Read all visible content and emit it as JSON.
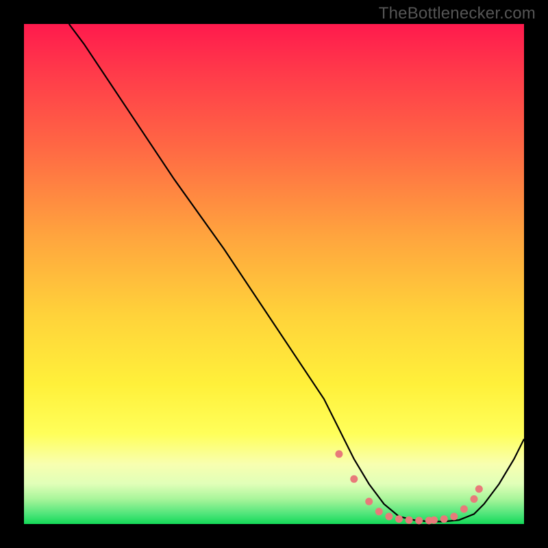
{
  "watermark": "TheBottlenecker.com",
  "chart_data": {
    "type": "line",
    "title": "",
    "xlabel": "",
    "ylabel": "",
    "xlim": [
      0,
      100
    ],
    "ylim": [
      0,
      100
    ],
    "series": [
      {
        "name": "curve",
        "x": [
          9,
          12,
          20,
          30,
          40,
          50,
          60,
          63,
          66,
          69,
          72,
          75,
          78,
          81,
          84,
          87,
          90,
          92,
          95,
          98,
          100
        ],
        "y": [
          100,
          96,
          84,
          69,
          55,
          40,
          25,
          19,
          13,
          8,
          4,
          1.5,
          0.8,
          0.5,
          0.5,
          0.8,
          2,
          4,
          8,
          13,
          17
        ]
      }
    ],
    "markers": {
      "name": "dots",
      "color": "#e87a7a",
      "x": [
        63,
        66,
        69,
        71,
        73,
        75,
        77,
        79,
        81,
        82,
        84,
        86,
        88,
        90,
        91
      ],
      "y": [
        14,
        9,
        4.5,
        2.5,
        1.5,
        1,
        0.8,
        0.7,
        0.7,
        0.8,
        1,
        1.5,
        3,
        5,
        7
      ]
    },
    "gradient_stops": [
      {
        "pos": 0,
        "color": "#ff1a4d"
      },
      {
        "pos": 50,
        "color": "#ffe03a"
      },
      {
        "pos": 100,
        "color": "#14d957"
      }
    ]
  }
}
